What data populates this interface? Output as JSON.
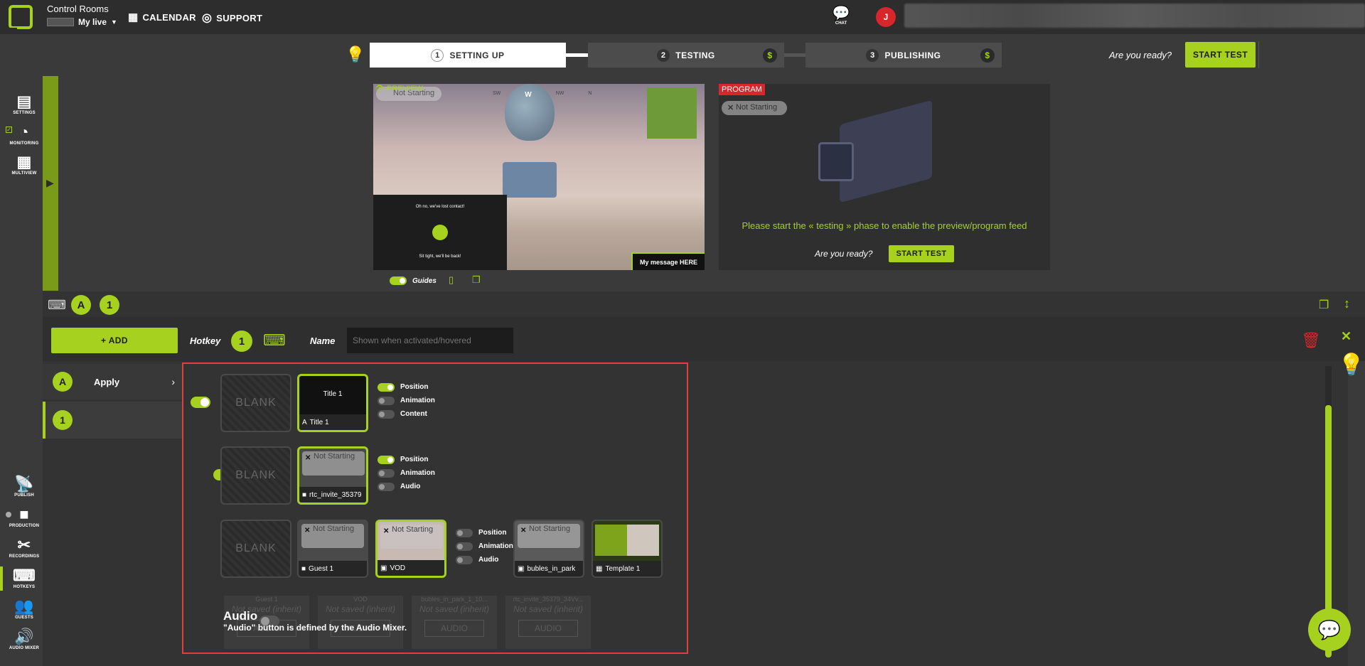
{
  "app": {
    "title": "Control Rooms",
    "subtitle": "My live",
    "nav": {
      "calendar": "CALENDAR",
      "support": "SUPPORT"
    },
    "chat_label": "CHAT",
    "avatar_initial": "J"
  },
  "steps": [
    {
      "num": "1",
      "label": "SETTING UP"
    },
    {
      "num": "2",
      "label": "TESTING",
      "badge": "$"
    },
    {
      "num": "3",
      "label": "PUBLISHING",
      "badge": "$"
    }
  ],
  "ready": {
    "question": "Are you ready?",
    "button": "START TEST"
  },
  "sidebar": {
    "top": [
      {
        "label": "SETTINGS"
      },
      {
        "label": "MONITORING"
      },
      {
        "label": "MULTIVIEW"
      }
    ],
    "bottom": [
      {
        "label": "PUBLISH"
      },
      {
        "label": "PRODUCTION"
      },
      {
        "label": "RECORDINGS"
      },
      {
        "label": "HOTKEYS"
      },
      {
        "label": "GUESTS"
      },
      {
        "label": "AUDIO MIXER"
      }
    ]
  },
  "preview": {
    "label": "PREVIEW",
    "status": "Not Starting",
    "lost_title": "Oh no, we've lost contact!",
    "lost_sub": "Sit tight, we'll be back!",
    "message": "My message HERE",
    "compass": [
      "SW",
      "W",
      "NW",
      "N"
    ],
    "guides_label": "Guides"
  },
  "program": {
    "label": "PROGRAM",
    "status": "Not Starting",
    "message": "Please start the « testing » phase to enable the preview/program feed",
    "question": "Are you ready?",
    "button": "START TEST"
  },
  "hotkey_bar": {
    "group": "A",
    "number": "1"
  },
  "editor": {
    "add_button": "+ ADD",
    "hotkey_label": "Hotkey",
    "hotkey_number": "1",
    "name_label": "Name",
    "name_placeholder": "Shown when activated/hovered"
  },
  "list": [
    {
      "badge": "A",
      "label": "Apply"
    },
    {
      "badge": "1",
      "label": ""
    }
  ],
  "rows": {
    "blank_label": "BLANK",
    "not_starting": "Not Starting",
    "row1": {
      "tile": "Title 1",
      "caption": "Title 1",
      "options": [
        "Position",
        "Animation",
        "Content"
      ]
    },
    "row2": {
      "caption": "rtc_invite_35379",
      "options": [
        "Position",
        "Animation",
        "Audio"
      ]
    },
    "row3": {
      "tiles": [
        "Guest 1",
        "VOD",
        "bubles_in_park",
        "Template 1"
      ],
      "options": [
        "Position",
        "Animation",
        "Audio"
      ]
    },
    "audio": {
      "title": "Audio",
      "description": "\"Audio\" button is defined by the Audio Mixer.",
      "ghosts": [
        {
          "name": "Guest 1",
          "state": "Not saved (inherit)",
          "button": "AUDIO"
        },
        {
          "name": "VOD",
          "state": "Not saved (inherit)",
          "button": "AUDIO"
        },
        {
          "name": "bubles_in_park_1_10...",
          "state": "Not saved (inherit)",
          "button": "AUDIO"
        },
        {
          "name": "rtc_invite_35379_34Vv...",
          "state": "Not saved (inherit)",
          "button": "AUDIO"
        }
      ]
    }
  },
  "colors": {
    "accent": "#a6d11f",
    "danger": "#d9262b",
    "highlight": "#e0403c"
  }
}
